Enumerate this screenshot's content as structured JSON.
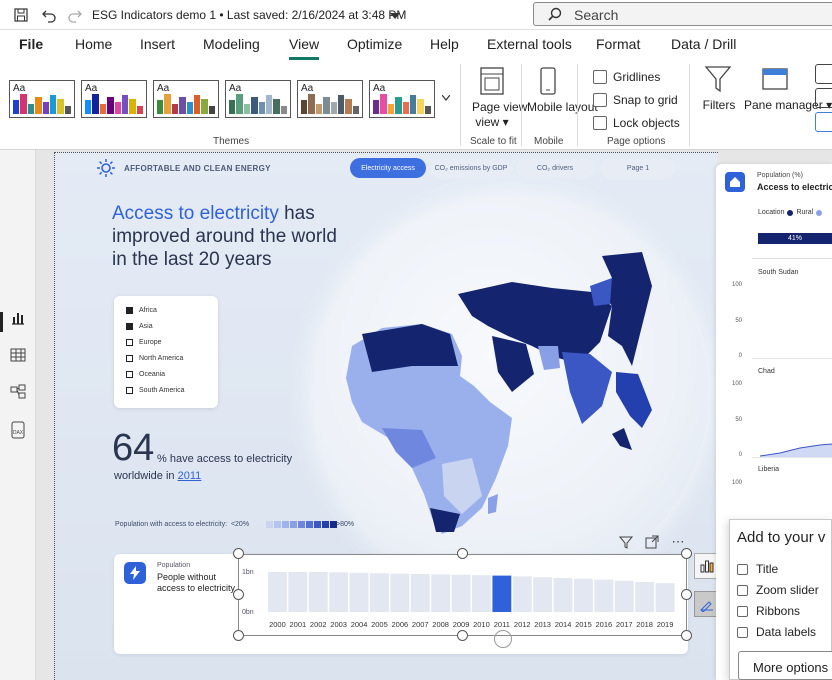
{
  "window": {
    "title": "ESG Indicators demo 1 • Last saved: 2/16/2024 at 3:48 PM",
    "search_placeholder": "Search",
    "icons": [
      "save-icon",
      "undo-icon",
      "redo-icon",
      "dropdown-caret-icon",
      "search-icon"
    ]
  },
  "menu": {
    "items": [
      "File",
      "Home",
      "Insert",
      "Modeling",
      "View",
      "Optimize",
      "Help",
      "External tools",
      "Format",
      "Data / Drill"
    ],
    "active": "View"
  },
  "ribbon": {
    "themes_label": "Themes",
    "themes": [
      {
        "colors": [
          "#1e3fd0",
          "#d3366e",
          "#2b8f8f",
          "#e68b17",
          "#7a3fbf",
          "#1b9ad2",
          "#d8c22b",
          "#555"
        ]
      },
      {
        "colors": [
          "#118dff",
          "#12239e",
          "#e66c37",
          "#6b007b",
          "#e044a7",
          "#744ec2",
          "#d9b300",
          "#d64550"
        ]
      },
      {
        "colors": [
          "#3d8b3d",
          "#e6a13a",
          "#b23a48",
          "#6c4fa3",
          "#2f8fc8",
          "#d95f2b",
          "#8aa83e",
          "#444"
        ]
      },
      {
        "colors": [
          "#3b6e57",
          "#5a9e7d",
          "#8cbf9e",
          "#3c5b7a",
          "#6e8fb0",
          "#a3b6cc",
          "#46705d",
          "#8b8b8b"
        ]
      },
      {
        "colors": [
          "#5b4636",
          "#8e6c4f",
          "#c29a6b",
          "#7c8b96",
          "#a2a9ae",
          "#4d5b68",
          "#b47c53",
          "#666"
        ]
      },
      {
        "colors": [
          "#6a2c91",
          "#e64fa0",
          "#f2a33a",
          "#2a9d8f",
          "#e76f51",
          "#457b9d",
          "#f4d35e",
          "#555"
        ]
      }
    ],
    "page_view_label": "Page view",
    "scale_to_fit_label": "Scale to fit",
    "mobile_layout_label": "Mobile layout",
    "mobile_label": "Mobile",
    "gridlines_label": "Gridlines",
    "snap_to_grid_label": "Snap to grid",
    "lock_objects_label": "Lock objects",
    "page_options_label": "Page options",
    "filters_label": "Filters",
    "pane_manager_label": "Pane manager"
  },
  "left_rail": {
    "icons": [
      "report-view-icon",
      "table-view-icon",
      "model-view-icon",
      "dax-query-icon"
    ]
  },
  "report": {
    "header_label": "AFFORTABLE AND CLEAN ENERGY",
    "tabs": [
      "Electricity access",
      "CO₂ emissions by GDP",
      "CO₂ drivers",
      "Page 1"
    ],
    "active_tab": "Electricity access",
    "headline_highlight": "Access to electricity",
    "headline_rest": " has improved around the world in the last 20 years",
    "legend": [
      {
        "label": "Africa",
        "checked": true
      },
      {
        "label": "Asia",
        "checked": true
      },
      {
        "label": "Europe",
        "checked": false
      },
      {
        "label": "North America",
        "checked": false
      },
      {
        "label": "Oceania",
        "checked": false
      },
      {
        "label": "South America",
        "checked": false
      }
    ],
    "big_number": "64",
    "stat_suffix": "% have access to electricity",
    "stat_line2_prefix": "worldwide in ",
    "stat_year": "2011",
    "scale_label": "Population with access to electricity:",
    "scale_low": "<20%",
    "scale_high": ">80%",
    "scale_colors": [
      "#c9d4f0",
      "#b5c4ee",
      "#9fb2ea",
      "#8aa0e6",
      "#6f87de",
      "#5470d4",
      "#3a57c4",
      "#243fae",
      "#142a8c"
    ],
    "bottom_card": {
      "label1": "Population",
      "label2": "People without access to electricity"
    },
    "visual_toolbar_icons": [
      "filter-icon",
      "focus-mode-icon",
      "more-options-icon"
    ]
  },
  "chart_data": {
    "type": "bar",
    "categories": [
      "2000",
      "2001",
      "2002",
      "2003",
      "2004",
      "2005",
      "2006",
      "2007",
      "2008",
      "2009",
      "2010",
      "2011",
      "2012",
      "2013",
      "2014",
      "2015",
      "2016",
      "2017",
      "2018",
      "2019"
    ],
    "values": [
      1.0,
      1.0,
      1.0,
      0.99,
      0.98,
      0.97,
      0.96,
      0.95,
      0.94,
      0.93,
      0.92,
      0.91,
      0.89,
      0.87,
      0.85,
      0.83,
      0.81,
      0.78,
      0.75,
      0.72
    ],
    "highlight": "2011",
    "y_ticks": [
      "1bn",
      "0bn"
    ],
    "ylim": [
      0,
      1.2
    ],
    "bar_color": "#e3e7f1",
    "highlight_color": "#2f62d8"
  },
  "right_visual": {
    "label1": "Population (%)",
    "label2": "Access to electric",
    "location_label": "Location",
    "location_series": [
      {
        "name": "Rural",
        "color": "#14246e"
      },
      {
        "name": "",
        "color": "#8aa3e8"
      }
    ],
    "bar_value": "41%",
    "countries": [
      "South Sudan",
      "Chad",
      "Liberia"
    ],
    "ticks": [
      "100",
      "50",
      "0",
      "100",
      "50",
      "0",
      "100"
    ]
  },
  "add_panel": {
    "title": "Add to your v",
    "options": [
      "Title",
      "Zoom slider",
      "Ribbons",
      "Data labels"
    ],
    "more_button": "More options"
  }
}
